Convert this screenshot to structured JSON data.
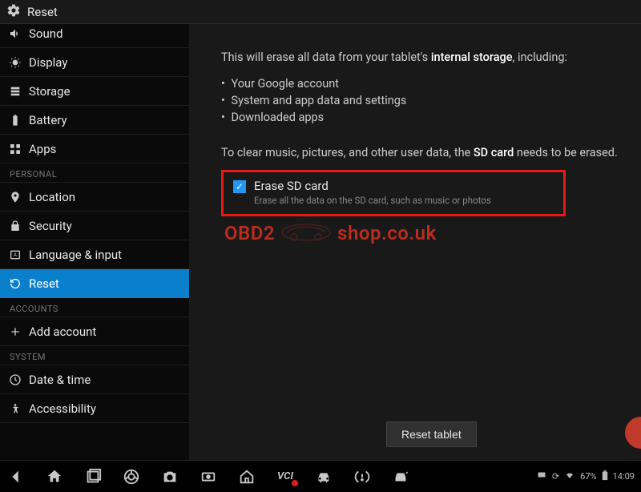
{
  "header": {
    "title": "Reset"
  },
  "sidebar": {
    "items": [
      {
        "label": "Sound"
      },
      {
        "label": "Display"
      },
      {
        "label": "Storage"
      },
      {
        "label": "Battery"
      },
      {
        "label": "Apps"
      }
    ],
    "section_personal": "PERSONAL",
    "personal_items": [
      {
        "label": "Location"
      },
      {
        "label": "Security"
      },
      {
        "label": "Language & input"
      },
      {
        "label": "Reset"
      }
    ],
    "section_accounts": "ACCOUNTS",
    "accounts_items": [
      {
        "label": "Add account"
      }
    ],
    "section_system": "SYSTEM",
    "system_items": [
      {
        "label": "Date & time"
      },
      {
        "label": "Accessibility"
      }
    ]
  },
  "content": {
    "lead_prefix": "This will erase all data from your tablet's ",
    "lead_bold": "internal storage",
    "lead_suffix": ", including:",
    "bullets": [
      "Your Google account",
      "System and app data and settings",
      "Downloaded apps"
    ],
    "sd_prefix": "To clear music, pictures, and other user data, the ",
    "sd_bold": "SD card",
    "sd_suffix": " needs to be erased.",
    "erase": {
      "title": "Erase SD card",
      "sub": "Erase all the data on the SD card, such as music or photos",
      "checked": true
    },
    "reset_button": "Reset tablet"
  },
  "watermark": {
    "left": "OBD2",
    "right": "shop.co.uk"
  },
  "statusbar": {
    "battery_pct": "67%",
    "time": "14:09",
    "vci_label": "VCI"
  }
}
